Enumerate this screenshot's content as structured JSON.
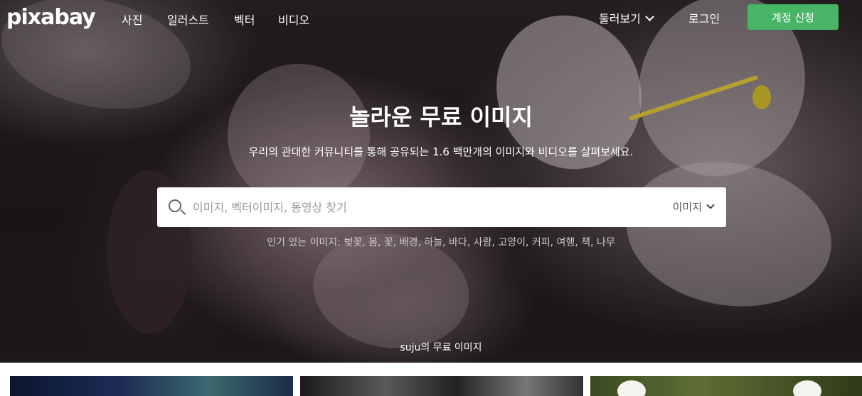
{
  "nav": {
    "logo": "pixabay",
    "links": [
      "사진",
      "일러스트",
      "벡터",
      "비디오"
    ],
    "explore": "둘러보기",
    "login": "로그인",
    "signup": "계정 신청"
  },
  "hero": {
    "headline": "놀라운 무료 이미지",
    "subline": "우리의 관대한 커뮤니티를 통해 공유되는 1.6 백만개의 이미지와 비디오를 살펴보세요.",
    "search_placeholder": "이미지, 벡터이미지, 동영상 찾기",
    "search_type": "이미지",
    "popular_label": "인기 있는 이미지:",
    "popular_tags": "벚꽃, 봄, 꽃, 배경, 하늘, 바다, 사람, 고양이, 커피, 여행, 책, 나무",
    "credit": "suju의 무료 이미지"
  },
  "icons": {
    "search": "search-icon",
    "chevron": "chevron-down-icon"
  },
  "colors": {
    "signup": "#47b565"
  }
}
